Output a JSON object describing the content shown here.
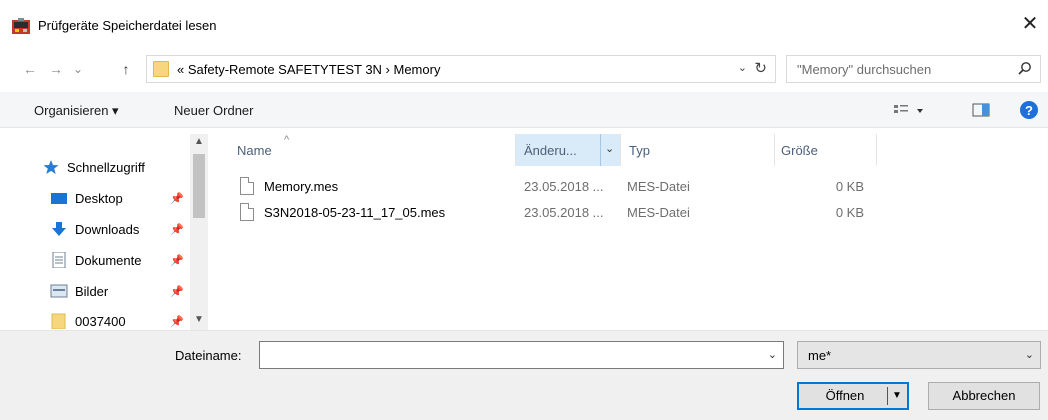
{
  "window": {
    "title": "Prüfgeräte Speicherdatei lesen",
    "close_glyph": "✕"
  },
  "nav": {
    "back_glyph": "←",
    "forward_glyph": "→",
    "recent_glyph": "⌄",
    "up_glyph": "↑",
    "breadcrumb": "«  Safety-Remote SAFETYTEST 3N  ›  Memory",
    "dropdown_glyph": "⌄",
    "refresh_glyph": "↻",
    "search_placeholder": "\"Memory\" durchsuchen"
  },
  "toolbar": {
    "organize_label": "Organisieren ▾",
    "new_folder_label": "Neuer Ordner"
  },
  "sidebar": {
    "items": [
      {
        "label": "Schnellzugriff",
        "icon": "star-icon"
      },
      {
        "label": "Desktop",
        "icon": "desktop-icon",
        "pinned": true
      },
      {
        "label": "Downloads",
        "icon": "download-icon",
        "pinned": true
      },
      {
        "label": "Dokumente",
        "icon": "documents-icon",
        "pinned": true
      },
      {
        "label": "Bilder",
        "icon": "pictures-icon",
        "pinned": true
      },
      {
        "label": "0037400",
        "icon": "folder-icon",
        "pinned": true
      }
    ],
    "pin_glyph": "📌"
  },
  "columns": {
    "name": "Name",
    "date": "Änderu...",
    "type": "Typ",
    "size": "Größe",
    "sort_glyph": "^",
    "date_dd_glyph": "⌄"
  },
  "files": [
    {
      "name": "Memory.mes",
      "date": "23.05.2018 ...",
      "type": "MES-Datei",
      "size": "0 KB"
    },
    {
      "name": "S3N2018-05-23-11_17_05.mes",
      "date": "23.05.2018 ...",
      "type": "MES-Datei",
      "size": "0 KB"
    }
  ],
  "bottom": {
    "filename_label": "Dateiname:",
    "filename_value": "",
    "filter_value": "me*",
    "open_label": "Öffnen",
    "cancel_label": "Abbrechen"
  },
  "colors": {
    "accent": "#0078d7",
    "header_active": "#d9ebf9",
    "header_text": "#4c607a"
  }
}
